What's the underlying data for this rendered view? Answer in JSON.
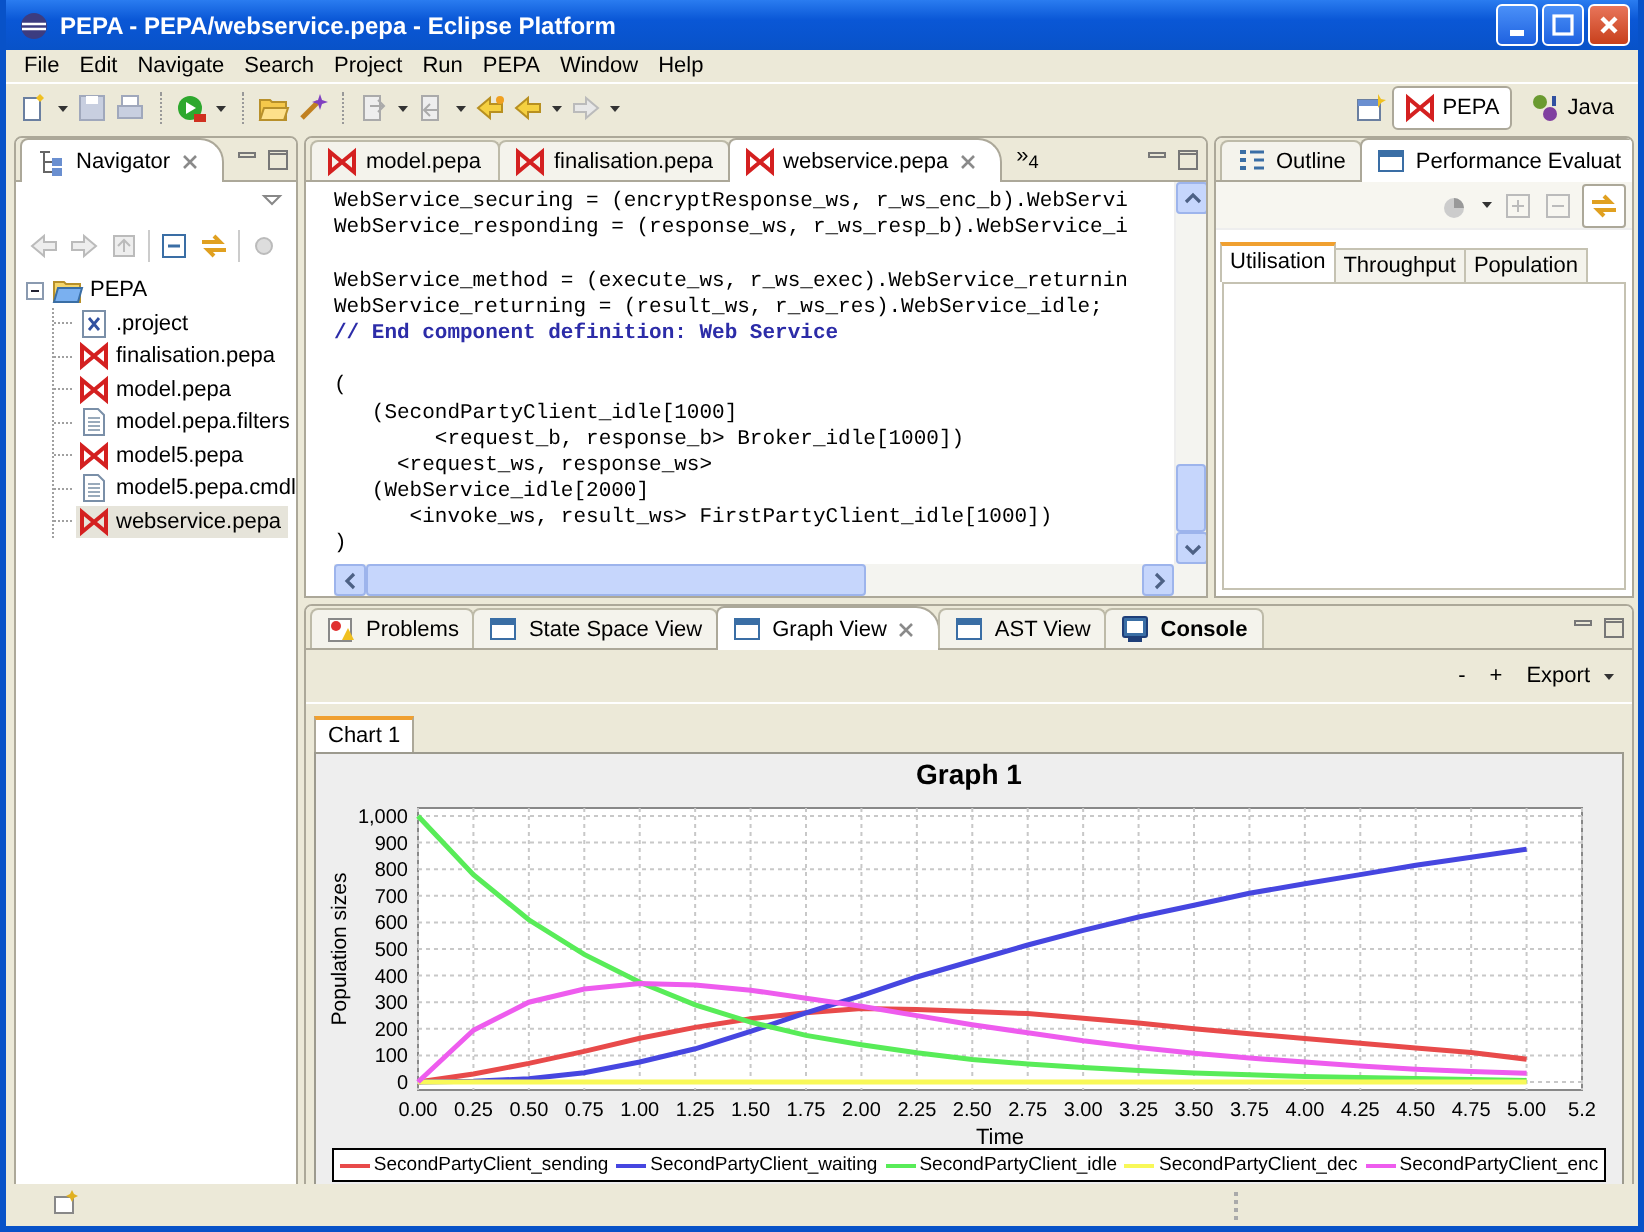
{
  "window": {
    "title": "PEPA - PEPA/webservice.pepa - Eclipse Platform"
  },
  "menu": [
    "File",
    "Edit",
    "Navigate",
    "Search",
    "Project",
    "Run",
    "PEPA",
    "Window",
    "Help"
  ],
  "perspectives": [
    {
      "label": "PEPA",
      "selected": true
    },
    {
      "label": "Java",
      "selected": false
    }
  ],
  "navigator": {
    "title": "Navigator",
    "tree": [
      {
        "label": "PEPA",
        "kind": "project",
        "expanded": true,
        "selected": false,
        "children": [
          {
            "label": ".project",
            "kind": "xml",
            "selected": false
          },
          {
            "label": "finalisation.pepa",
            "kind": "pepa",
            "selected": false
          },
          {
            "label": "model.pepa",
            "kind": "pepa",
            "selected": false
          },
          {
            "label": "model.pepa.filters",
            "kind": "file",
            "selected": false
          },
          {
            "label": "model5.pepa",
            "kind": "pepa",
            "selected": false
          },
          {
            "label": "model5.pepa.cmdl",
            "kind": "file",
            "selected": false
          },
          {
            "label": "webservice.pepa",
            "kind": "pepa",
            "selected": true
          }
        ]
      }
    ]
  },
  "editor": {
    "tabs": [
      {
        "label": "model.pepa",
        "selected": false
      },
      {
        "label": "finalisation.pepa",
        "selected": false
      },
      {
        "label": "webservice.pepa",
        "selected": true
      }
    ],
    "overflow": "»$_{4}$",
    "lines": [
      {
        "kind": "code",
        "text": "WebService_securing = (encryptResponse_ws, r_ws_enc_b).WebServi"
      },
      {
        "kind": "code",
        "text": "WebService_responding = (response_ws, r_ws_resp_b).WebService_i"
      },
      {
        "kind": "blank"
      },
      {
        "kind": "code",
        "text": "WebService_method = (execute_ws, r_ws_exec).WebService_returnin"
      },
      {
        "kind": "code",
        "text": "WebService_returning = (result_ws, r_ws_res).WebService_idle;"
      },
      {
        "kind": "comment",
        "text": "// End component definition: Web Service"
      },
      {
        "kind": "blank"
      },
      {
        "kind": "code",
        "text": "("
      },
      {
        "kind": "code",
        "text": "   (SecondPartyClient_idle[1000]"
      },
      {
        "kind": "code",
        "text": "        <request_b, response_b> Broker_idle[1000])"
      },
      {
        "kind": "code",
        "text": "     <request_ws, response_ws>"
      },
      {
        "kind": "code",
        "text": "   (WebService_idle[2000]"
      },
      {
        "kind": "code",
        "text": "      <invoke_ws, result_ws> FirstPartyClient_idle[1000])"
      },
      {
        "kind": "code",
        "text": ")"
      }
    ]
  },
  "side_panel": {
    "tabs": [
      {
        "label": "Outline",
        "kind": "outline",
        "selected": false
      },
      {
        "label": "Performance Evaluat",
        "kind": "view",
        "selected": true
      }
    ],
    "subtabs": [
      {
        "label": "Utilisation",
        "selected": true
      },
      {
        "label": "Throughput",
        "selected": false
      },
      {
        "label": "Population",
        "selected": false
      }
    ]
  },
  "bottom_panel": {
    "tabs": [
      {
        "label": "Problems",
        "kind": "problems",
        "selected": false,
        "emphasized": false
      },
      {
        "label": "State Space View",
        "kind": "view",
        "selected": false,
        "emphasized": false
      },
      {
        "label": "Graph View",
        "kind": "view",
        "selected": true,
        "emphasized": false
      },
      {
        "label": "AST View",
        "kind": "view",
        "selected": false,
        "emphasized": false
      },
      {
        "label": "Console",
        "kind": "console",
        "selected": false,
        "emphasized": true
      }
    ],
    "actions": [
      {
        "label": "-",
        "kind": "button"
      },
      {
        "label": "+",
        "kind": "button"
      },
      {
        "label": "Export",
        "kind": "menu"
      }
    ],
    "chart_tabs": [
      {
        "label": "Chart 1",
        "selected": true
      }
    ],
    "chart_data": {
      "type": "line",
      "title": "Graph 1",
      "xlabel": "Time",
      "ylabel": "Population sizes",
      "x": [
        0,
        0.25,
        0.5,
        0.75,
        1,
        1.25,
        1.5,
        1.75,
        2,
        2.25,
        2.5,
        2.75,
        3,
        3.25,
        3.5,
        3.75,
        4,
        4.25,
        4.5,
        4.75,
        5
      ],
      "series": [
        {
          "name": "SecondPartyClient_sending",
          "color": "#e84a4a",
          "values": [
            0,
            30,
            70,
            115,
            165,
            205,
            238,
            260,
            276,
            272,
            265,
            257,
            240,
            222,
            200,
            181,
            163,
            146,
            128,
            111,
            86
          ]
        },
        {
          "name": "SecondPartyClient_waiting",
          "color": "#4646e0",
          "values": [
            0,
            3,
            12,
            35,
            75,
            125,
            190,
            260,
            325,
            395,
            455,
            515,
            570,
            620,
            665,
            710,
            745,
            780,
            815,
            845,
            875
          ]
        },
        {
          "name": "SecondPartyClient_idle",
          "color": "#58ec58",
          "values": [
            1000,
            780,
            610,
            480,
            375,
            290,
            225,
            175,
            140,
            110,
            85,
            68,
            55,
            43,
            34,
            27,
            21,
            17,
            13,
            10,
            6
          ]
        },
        {
          "name": "SecondPartyClient_dec",
          "color": "#f8f858",
          "values": [
            0,
            0,
            0,
            0,
            0,
            0,
            0,
            0,
            0,
            0,
            0,
            0,
            0,
            0,
            0,
            0,
            0,
            0,
            0,
            0,
            0
          ]
        },
        {
          "name": "SecondPartyClient_enc",
          "color": "#ee5cee",
          "values": [
            0,
            195,
            300,
            350,
            370,
            365,
            345,
            315,
            285,
            250,
            215,
            185,
            155,
            130,
            108,
            90,
            75,
            60,
            48,
            40,
            33
          ]
        }
      ],
      "xlim": [
        0,
        5.25
      ],
      "ylim": [
        -30,
        1030
      ],
      "grid": true,
      "xticks": [
        {
          "value": 0,
          "label": "0.00"
        },
        {
          "value": 0.25,
          "label": "0.25"
        },
        {
          "value": 0.5,
          "label": "0.50"
        },
        {
          "value": 0.75,
          "label": "0.75"
        },
        {
          "value": 1,
          "label": "1.00"
        },
        {
          "value": 1.25,
          "label": "1.25"
        },
        {
          "value": 1.5,
          "label": "1.50"
        },
        {
          "value": 1.75,
          "label": "1.75"
        },
        {
          "value": 2,
          "label": "2.00"
        },
        {
          "value": 2.25,
          "label": "2.25"
        },
        {
          "value": 2.5,
          "label": "2.50"
        },
        {
          "value": 2.75,
          "label": "2.75"
        },
        {
          "value": 3,
          "label": "3.00"
        },
        {
          "value": 3.25,
          "label": "3.25"
        },
        {
          "value": 3.5,
          "label": "3.50"
        },
        {
          "value": 3.75,
          "label": "3.75"
        },
        {
          "value": 4,
          "label": "4.00"
        },
        {
          "value": 4.25,
          "label": "4.25"
        },
        {
          "value": 4.5,
          "label": "4.50"
        },
        {
          "value": 4.75,
          "label": "4.75"
        },
        {
          "value": 5,
          "label": "5.00"
        },
        {
          "value": 5.25,
          "label": "5.2"
        }
      ],
      "yticks": [
        0,
        100,
        200,
        300,
        400,
        500,
        600,
        700,
        800,
        900,
        {
          "value": 1000,
          "label": "1,000"
        }
      ]
    }
  }
}
